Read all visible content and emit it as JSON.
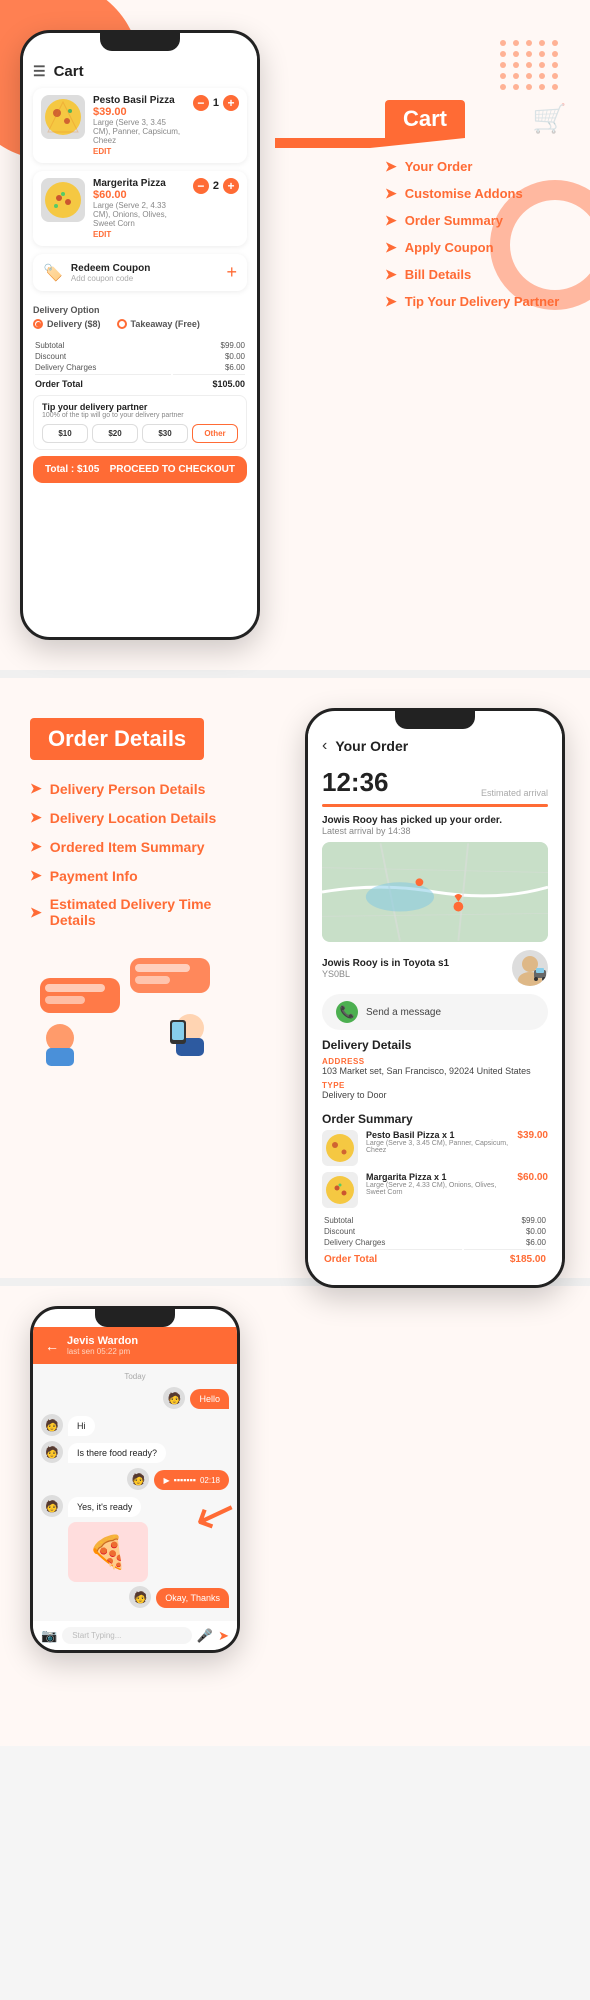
{
  "top": {
    "cart_label": "Cart",
    "items": [
      {
        "name": "Pesto Basil Pizza",
        "price": "$39.00",
        "desc": "Large (Serve 3, 3.45 CM), Panner, Capsicum, Cheez",
        "edit": "EDIT",
        "qty": 1
      },
      {
        "name": "Margerita Pizza",
        "price": "$60.00",
        "desc": "Large (Serve 2, 4.33 CM), Onions, Olives, Sweet Corn",
        "edit": "EDIT",
        "qty": 2
      }
    ],
    "coupon": {
      "title": "Redeem Coupon",
      "sub": "Add coupon code"
    },
    "delivery_option_label": "Delivery Option",
    "delivery": "Delivery ($8)",
    "takeaway": "Takeaway (Free)",
    "bill": {
      "subtotal_label": "Subtotal",
      "subtotal": "$99.00",
      "discount_label": "Discount",
      "discount": "$0.00",
      "delivery_label": "Delivery Charges",
      "delivery": "$6.00",
      "total_label": "Order Total",
      "total": "$105.00"
    },
    "tip": {
      "title": "Tip your delivery partner",
      "sub": "100% of the tip will go to your delivery partner",
      "amounts": [
        "$10",
        "$20",
        "$30"
      ],
      "other": "Other"
    },
    "checkout_total": "Total : $105",
    "checkout_btn": "PROCEED TO CHECKOUT"
  },
  "cart_labels": {
    "title": "Cart",
    "items": [
      "Your Order",
      "Customise Addons",
      "Order Summary",
      "Apply Coupon",
      "Bill Details",
      "Tip Your Delivery Partner"
    ]
  },
  "order_details": {
    "title": "Order Details",
    "nav": [
      "Delivery Person Details",
      "Delivery Location Details",
      "Ordered Item Summary",
      "Payment Info",
      "Estimated Delivery Time Details"
    ]
  },
  "order_screen": {
    "back_label": "Your Order",
    "time": "12:36",
    "estimated_arrival": "Estimated arrival",
    "pickup_text": "Jowis Rooy has picked up your order.",
    "latest_arrival": "Latest arrival by 14:38",
    "driver": {
      "name": "Jowis Rooy is in Toyota s1",
      "plate": "YS0BL"
    },
    "send_message": "Send a message",
    "delivery_details": {
      "title": "Delivery Details",
      "address_label": "ADDRESS",
      "address": "103 Market set, San Francisco, 92024 United States",
      "type_label": "TYPE",
      "type": "Delivery to Door"
    },
    "order_summary": {
      "title": "Order Summary",
      "items": [
        {
          "name": "Pesto Basil Pizza x 1",
          "desc": "Large (Serve 3, 3.45 CM), Panner, Capsicum, Cheez",
          "price": "$39.00"
        },
        {
          "name": "Margarita Pizza x 1",
          "desc": "Large (Serve 2, 4.33 CM), Onions, Olives, Sweet Corn",
          "price": "$60.00"
        }
      ],
      "subtotal_label": "Subtotal",
      "subtotal": "$99.00",
      "discount_label": "Discount",
      "discount": "$0.00",
      "delivery_label": "Delivery Charges",
      "delivery": "$6.00",
      "total_label": "Order Total",
      "total": "$185.00"
    }
  },
  "chat": {
    "person_name": "Jevis Wardon",
    "last_seen": "last sen 05:22 pm",
    "date_label": "Today",
    "messages": [
      {
        "type": "sent",
        "text": "Hello",
        "avatar": false
      },
      {
        "type": "recv",
        "text": "Hi",
        "avatar": true
      },
      {
        "type": "recv",
        "text": "Is there food ready?",
        "avatar": true
      },
      {
        "type": "sent",
        "text": "audio:02:18",
        "avatar": false
      },
      {
        "type": "recv",
        "text": "Yes, it's ready",
        "avatar": true
      },
      {
        "type": "sent",
        "text": "Okay, Thanks",
        "avatar": false
      }
    ],
    "input_placeholder": "Start Typing...",
    "footer_icons": [
      "camera",
      "mic",
      "send"
    ]
  }
}
